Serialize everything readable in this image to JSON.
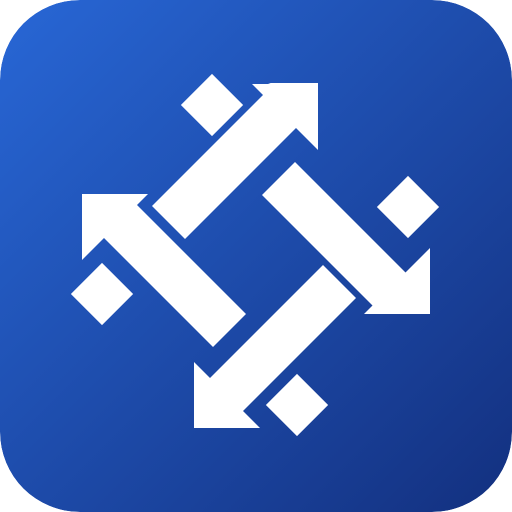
{
  "app_icon": {
    "icon": "four-arrows-pinwheel-icon",
    "colors": {
      "background_light": "#2867d6",
      "background_dark": "#13307f",
      "glyph": "#ffffff"
    }
  }
}
